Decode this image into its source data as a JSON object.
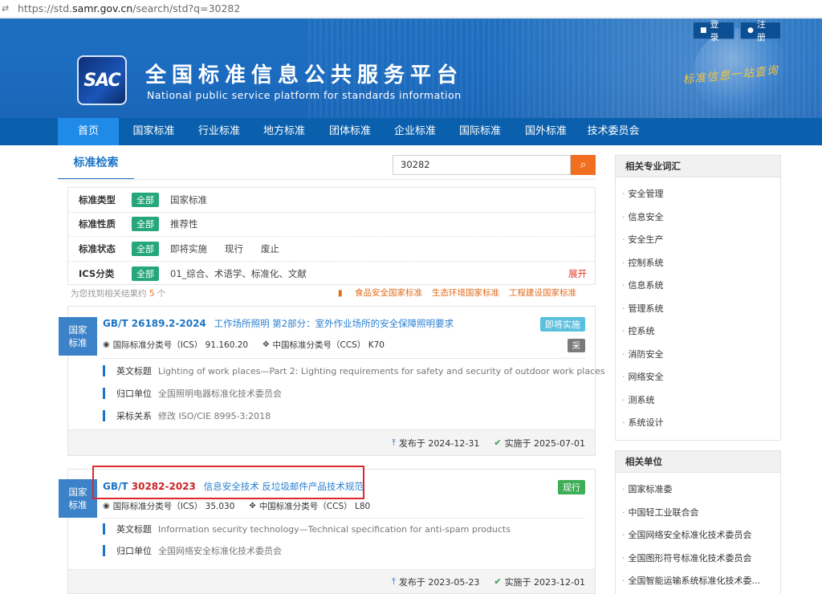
{
  "browser": {
    "url_prefix": "https://std.",
    "url_host": "samr.gov.cn",
    "url_suffix": "/search/std?q=30282"
  },
  "header": {
    "login": "登录",
    "register": "注册",
    "logo_text": "SAC",
    "title": "全国标准信息公共服务平台",
    "subtitle": "National public service platform  for standards information",
    "slogan": "标准信息一站查询"
  },
  "nav": [
    "首页",
    "国家标准",
    "行业标准",
    "地方标准",
    "团体标准",
    "企业标准",
    "国际标准",
    "国外标准",
    "技术委员会"
  ],
  "search": {
    "tab": "标准检索",
    "query": "30282"
  },
  "filters": {
    "all_label": "全部",
    "rows": [
      {
        "label": "标准类型",
        "options": [
          "国家标准"
        ]
      },
      {
        "label": "标准性质",
        "options": [
          "推荐性"
        ]
      },
      {
        "label": "标准状态",
        "options": [
          "即将实施",
          "现行",
          "废止"
        ]
      },
      {
        "label": "ICS分类",
        "options": [
          "01_综合、术语学、标准化、文献"
        ],
        "expand": "展开"
      }
    ]
  },
  "results": {
    "count_prefix": "为您找到相关结果约",
    "count": "5",
    "count_suffix": "个",
    "quick_links": [
      "食品安全国家标准",
      "生态环境国家标准",
      "工程建设国家标准"
    ],
    "items": [
      {
        "category": "国家\n标准",
        "code_prefix": "GB/T 26189.2-2024",
        "code_hl": "",
        "code_suffix": "",
        "name": "工作场所照明 第2部分：室外作业场所的安全保障照明要求",
        "status": "即将实施",
        "adopt": "采",
        "ics_label": "国际标准分类号（ICS）",
        "ics": "91.160.20",
        "ccs_label": "中国标准分类号（CCS）",
        "ccs": "K70",
        "details": [
          {
            "label": "英文标题",
            "value": "Lighting of work places—Part 2: Lighting requirements for safety and security of outdoor work places"
          },
          {
            "label": "归口单位",
            "value": "全国照明电器标准化技术委员会"
          },
          {
            "label": "采标关系",
            "value": "修改  ISO/CIE 8995-3:2018"
          }
        ],
        "published": "发布于 2024-12-31",
        "effective": "实施于 2025-07-01"
      },
      {
        "category": "国家\n标准",
        "code_prefix": "GB/T ",
        "code_hl": "30282-2023",
        "code_suffix": "",
        "name": "信息安全技术 反垃圾邮件产品技术规范",
        "status": "现行",
        "ics_label": "国际标准分类号（ICS）",
        "ics": "35.030",
        "ccs_label": "中国标准分类号（CCS）",
        "ccs": "L80",
        "details": [
          {
            "label": "英文标题",
            "value": "Information security technology—Technical specification for anti-spam products"
          },
          {
            "label": "归口单位",
            "value": "全国网络安全标准化技术委员会"
          }
        ],
        "published": "发布于 2023-05-23",
        "effective": "实施于 2023-12-01"
      }
    ]
  },
  "sidebar": {
    "terms_title": "相关专业词汇",
    "terms": [
      "安全管理",
      "信息安全",
      "安全生产",
      "控制系统",
      "信息系统",
      "管理系统",
      "控系统",
      "消防安全",
      "网络安全",
      "测系统",
      "系统设计"
    ],
    "units_title": "相关单位",
    "units": [
      "国家标准委",
      "中国轻工业联合会",
      "全国网络安全标准化技术委员会",
      "全国图形符号标准化技术委员会",
      "全国智能运输系统标准化技术委..."
    ]
  },
  "colors": {
    "nav_bg": "#0b60ad",
    "nav_active": "#1f8ae8",
    "accent_blue": "#1b74c6",
    "search_btn": "#f07020",
    "all_tag": "#26a77a",
    "status_current": "#3fae57",
    "status_upcoming": "#5bc0de",
    "highlight_red": "#e0262b"
  }
}
